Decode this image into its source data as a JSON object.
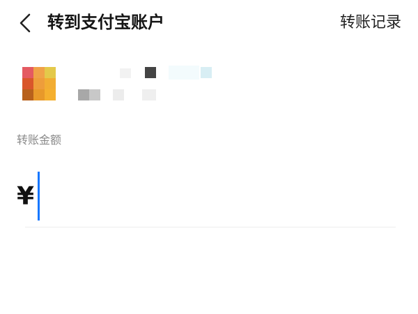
{
  "header": {
    "back_icon": "chevron-left-icon",
    "title": "转到支付宝账户",
    "records_label": "转账记录"
  },
  "payee": {
    "avatar_colors": [
      "#e45a62",
      "#f0a248",
      "#e4c94a",
      "#d9562b",
      "#ee9d3b",
      "#f2ad33",
      "#b8611c",
      "#e8992a",
      "#f5b02f"
    ]
  },
  "amount": {
    "label": "转账金额",
    "currency_symbol": "¥",
    "value": "",
    "caret_color": "#1677ff"
  }
}
